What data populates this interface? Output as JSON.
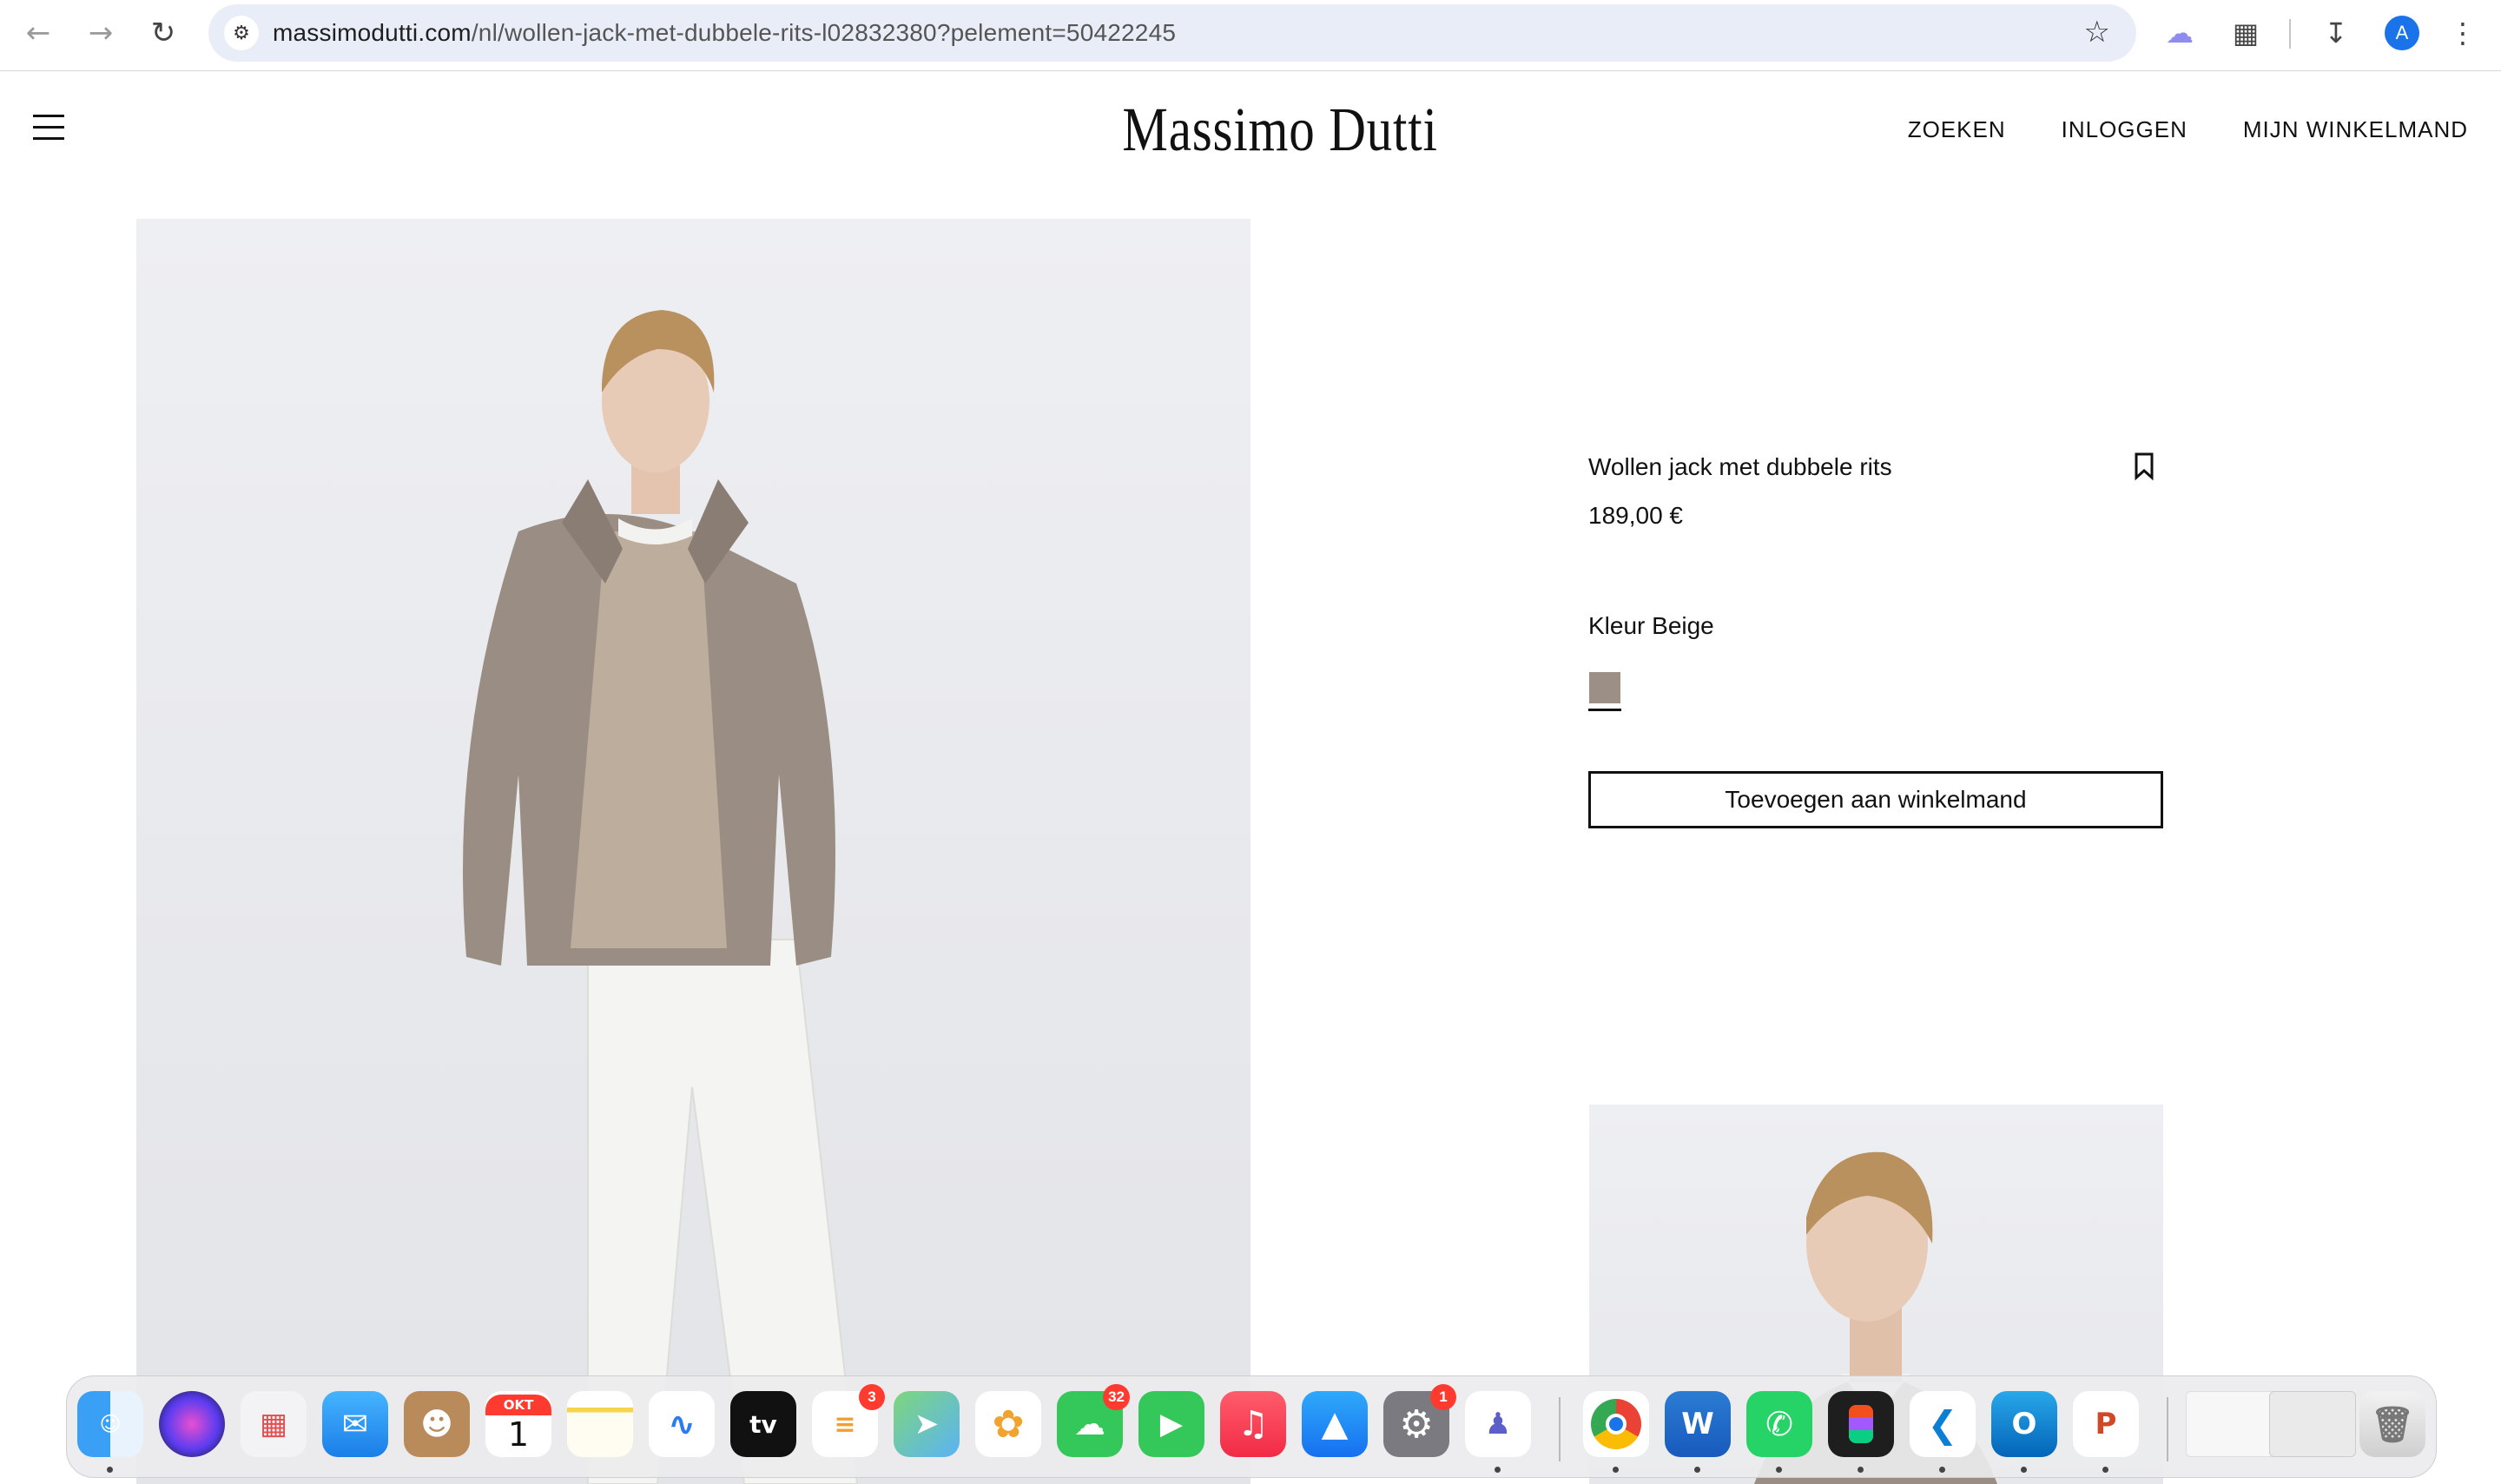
{
  "browser": {
    "url_domain": "massimodutti.com",
    "url_path": "/nl/wollen-jack-met-dubbele-rits-l02832380?pelement=50422245",
    "profile_initial": "A"
  },
  "header": {
    "logo": "Massimo Dutti",
    "links": {
      "search": "ZOEKEN",
      "login": "INLOGGEN",
      "cart": "MIJN WINKELMAND"
    }
  },
  "product": {
    "title": "Wollen jack met dubbele rits",
    "price": "189,00 €",
    "color_label": "Kleur Beige",
    "swatch_color": "#9b8f86",
    "add_to_cart": "Toevoegen aan winkelmand"
  },
  "dock": {
    "calendar_month": "OKT",
    "calendar_day": "1",
    "reminders_badge": "3",
    "messages_badge": "32",
    "settings_badge": "1",
    "tv_label": "tv",
    "word_label": "W",
    "outlook_label": "O",
    "powerpoint_label": "P"
  }
}
